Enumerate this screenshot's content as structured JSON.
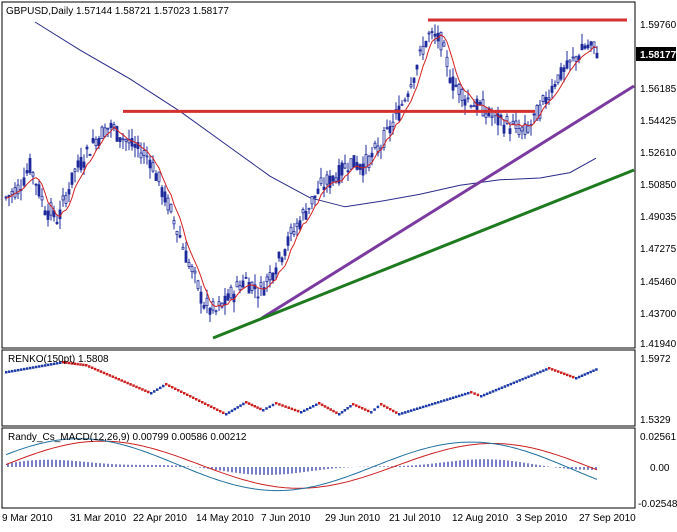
{
  "header": {
    "symbol_timeframe": "GBPUSD,Daily",
    "ohlc": "1.57144 1.58721 1.57023 1.58177"
  },
  "main_axis": {
    "labels": [
      "1.59760",
      "1.56185",
      "1.54425",
      "1.52610",
      "1.50850",
      "1.49035",
      "1.47275",
      "1.45460",
      "1.43700",
      "1.41940"
    ],
    "current_price": "1.58177",
    "min": 1.4194,
    "max": 1.5976
  },
  "renko": {
    "title": "RENKO(150pt) 1.5808",
    "axis_top": "1.5972",
    "axis_bottom": "1.5329"
  },
  "macd": {
    "title": "Randy_Cs_MACD(12,26,9) 0.00799 0.00586 0.00212",
    "axis_top": "0.02561",
    "axis_mid": "0.00",
    "axis_bottom": "-0.02548"
  },
  "x_axis": {
    "labels": [
      "9 Mar 2010",
      "31 Mar 2010",
      "22 Apr 2010",
      "14 May 2010",
      "7 Jun 2010",
      "29 Jun 2010",
      "21 Jul 2010",
      "12 Aug 2010",
      "3 Sep 2010",
      "27 Sep 2010"
    ]
  },
  "colors": {
    "background": "#ffffff",
    "bull_bar": "#1e2a9c",
    "bear_bar": "#1e2a9c",
    "fast_ma": "#d42020",
    "slow_ma": "#2a2a8a",
    "resistance_line": "#d43030",
    "purple_trendline": "#7a3aa0",
    "green_trendline": "#1e7a1e",
    "renko_up": "#1e3aa8",
    "renko_down": "#cc2020",
    "macd_hist": "#1e2a9c",
    "macd_signal": "#cc2020",
    "macd_line": "#2070a0",
    "price_tag_bg": "#000000",
    "price_tag_text": "#ffffff"
  },
  "chart_data": {
    "type": "line",
    "title": "GBPUSD,Daily",
    "x": [
      "9 Mar 2010",
      "31 Mar 2010",
      "22 Apr 2010",
      "14 May 2010",
      "7 Jun 2010",
      "29 Jun 2010",
      "21 Jul 2010",
      "12 Aug 2010",
      "3 Sep 2010",
      "27 Sep 2010"
    ],
    "series": [],
    "close_estimates": [
      1.5,
      1.53,
      1.525,
      1.445,
      1.44,
      1.505,
      1.568,
      1.557,
      1.545,
      1.58
    ],
    "ylim": [
      1.4194,
      1.5976
    ],
    "levels": {
      "resistance_top": 1.5976,
      "resistance_mid": 1.548
    }
  }
}
